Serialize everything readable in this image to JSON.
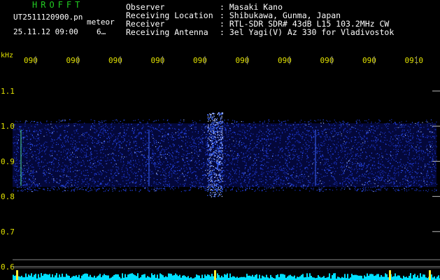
{
  "header": {
    "app_title": "HROFFT",
    "file_name": "UT2511120900.pn",
    "tag": "meteor",
    "datetime": "25.11.12 09:00",
    "count": "6…"
  },
  "station_info": [
    {
      "label": "Observer",
      "value": ": Masaki Kano"
    },
    {
      "label": "Receiving Location",
      "value": ": Shibukawa, Gunma, Japan"
    },
    {
      "label": "Receiver",
      "value": ": RTL-SDR SDR# 43dB L15 103.2MHz CW"
    },
    {
      "label": "Receiving Antenna",
      "value": ": 3el Yagi(V) Az 330 for Vladivostok"
    }
  ],
  "time_axis": {
    "labels": [
      "090",
      "090",
      "090",
      "090",
      "090",
      "090",
      "090",
      "090",
      "090",
      "0910"
    ]
  },
  "freq_axis": {
    "unit": "kHz",
    "labels": [
      "1.1",
      "1.0",
      "0.9",
      "0.8",
      "0.7",
      "0.6"
    ]
  },
  "colors": {
    "title_green": "#22cc22",
    "text_white": "#ffffff",
    "axis_yellow": "#e0e000",
    "noise_blue": "#2244ff",
    "baseline_cyan": "#00e0ff"
  }
}
